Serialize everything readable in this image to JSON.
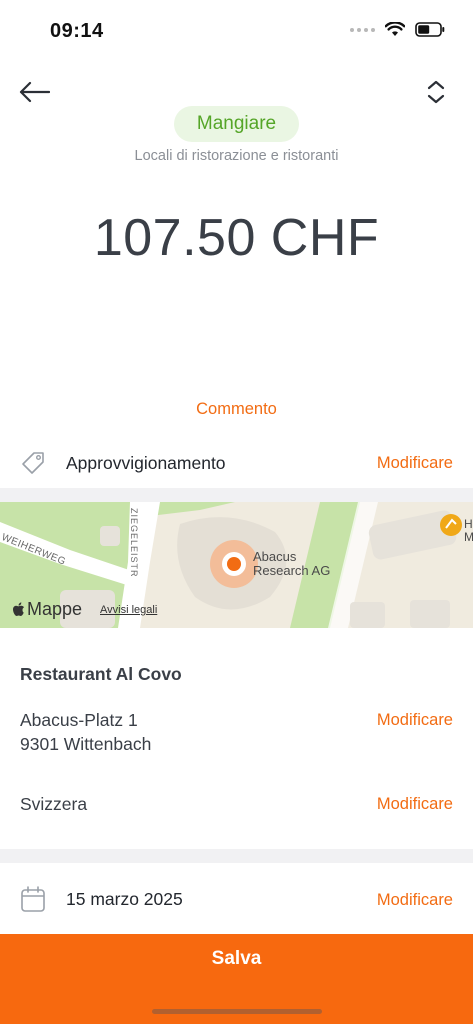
{
  "status_bar": {
    "time": "09:14"
  },
  "category": {
    "name": "Mangiare",
    "subtitle": "Locali di ristorazione e ristoranti",
    "color": "#55a528"
  },
  "amount": "107.50 CHF",
  "comment_link": "Commento",
  "tag_row": {
    "label": "Approvvigionamento",
    "edit": "Modificare",
    "icon": "tag-icon"
  },
  "map": {
    "place_label_line1": "Abacus",
    "place_label_line2": "Research AG",
    "street_left": "WEIHERWEG",
    "street_vertical": "ZIEGELEISTR",
    "poi_label": "H\nM",
    "brand": "Mappe",
    "legal": "Avvisi legali"
  },
  "location": {
    "name": "Restaurant Al Covo",
    "street": "Abacus-Platz 1",
    "city": "9301 Wittenbach",
    "country": "Svizzera",
    "edit_address": "Modificare",
    "edit_country": "Modificare"
  },
  "date_row": {
    "label": "15 marzo 2025",
    "edit": "Modificare",
    "icon": "calendar-icon"
  },
  "save_button": {
    "label": "Salva",
    "color": "#f7690f"
  },
  "accent_color": "#f26c13"
}
